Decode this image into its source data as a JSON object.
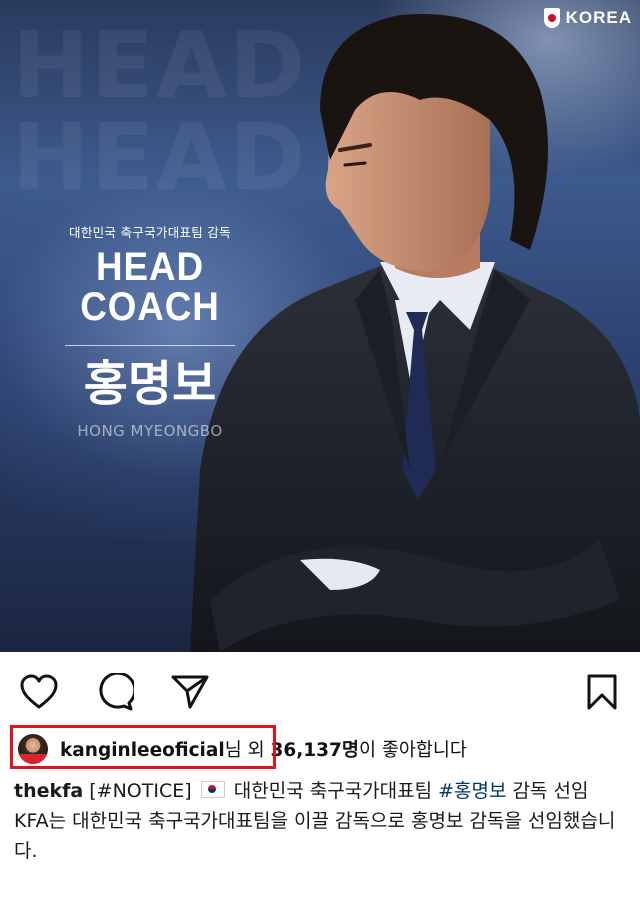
{
  "post_image": {
    "brand_text": "KOREA",
    "subtitle": "대한민국 축구국가대표팀 감독",
    "headline": "HEAD COACH",
    "name_korean": "홍명보",
    "name_english": "HONG MYEONGBO",
    "ghost_text": [
      "HEAD",
      "HEAD"
    ]
  },
  "actions": {
    "like_icon": "heart-icon",
    "comment_icon": "comment-icon",
    "share_icon": "send-icon",
    "save_icon": "bookmark-icon"
  },
  "likes": {
    "username": "kanginleeoficial",
    "honorific": "님",
    "connector": " 외 ",
    "count": "36,137명",
    "suffix": "이 좋아합니다"
  },
  "caption": {
    "handle": "thekfa",
    "notice_tag": "[#NOTICE]",
    "line1_text": " 대한민국 축구국가대표팀 ",
    "hashtag": "#홍명보",
    "line1_end": " 감독 선임",
    "body": "KFA는 대한민국 축구국가대표팀을 이끌 감독으로 홍명보 감독을 선임했습니다."
  },
  "colors": {
    "highlight_box": "#e0151c",
    "link": "#00376b"
  }
}
